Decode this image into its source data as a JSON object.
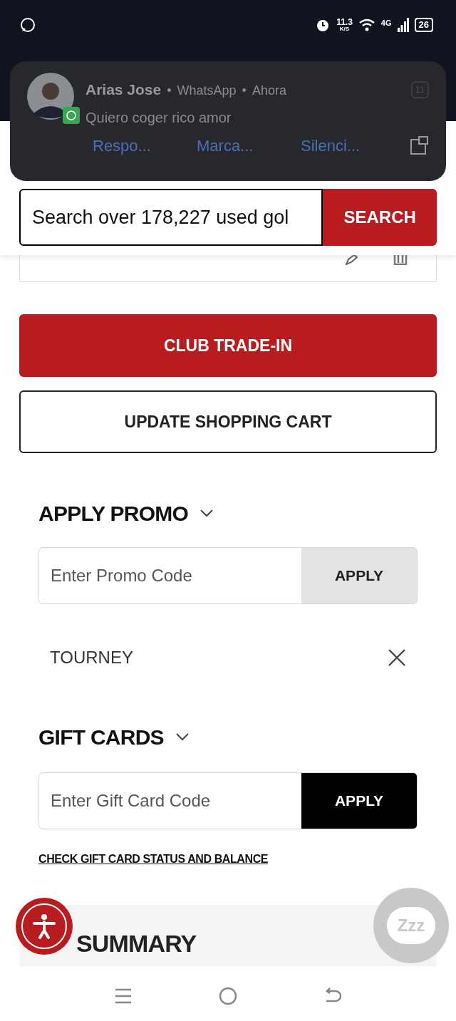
{
  "status_bar": {
    "speed": "11.3",
    "speed_unit": "K/S",
    "network": "4G",
    "battery": "26"
  },
  "notification": {
    "sender": "Arias Jose",
    "app": "WhatsApp",
    "time": "Ahora",
    "separators": [
      "•",
      "•"
    ],
    "message": "Quiero coger rico amor",
    "count": "11",
    "actions": [
      "Respo...",
      "Marca...",
      "Silenci..."
    ]
  },
  "search": {
    "placeholder": "Search over 178,227 used gol",
    "button": "SEARCH"
  },
  "buttons": [
    "CLUB TRADE-IN",
    "UPDATE SHOPPING CART"
  ],
  "promo": {
    "title": "APPLY PROMO",
    "expanded": true,
    "placeholder": "Enter Promo Code",
    "button": "APPLY",
    "applied": "TOURNEY"
  },
  "gift_cards": {
    "title": "GIFT CARDS",
    "expanded": true,
    "placeholder": "Enter Gift Card Code",
    "button": "APPLY",
    "link": "CHECK GIFT CARD STATUS AND BALANCE"
  },
  "summary": {
    "title": "SUMMARY"
  },
  "chat": {
    "label": "Zzz"
  }
}
